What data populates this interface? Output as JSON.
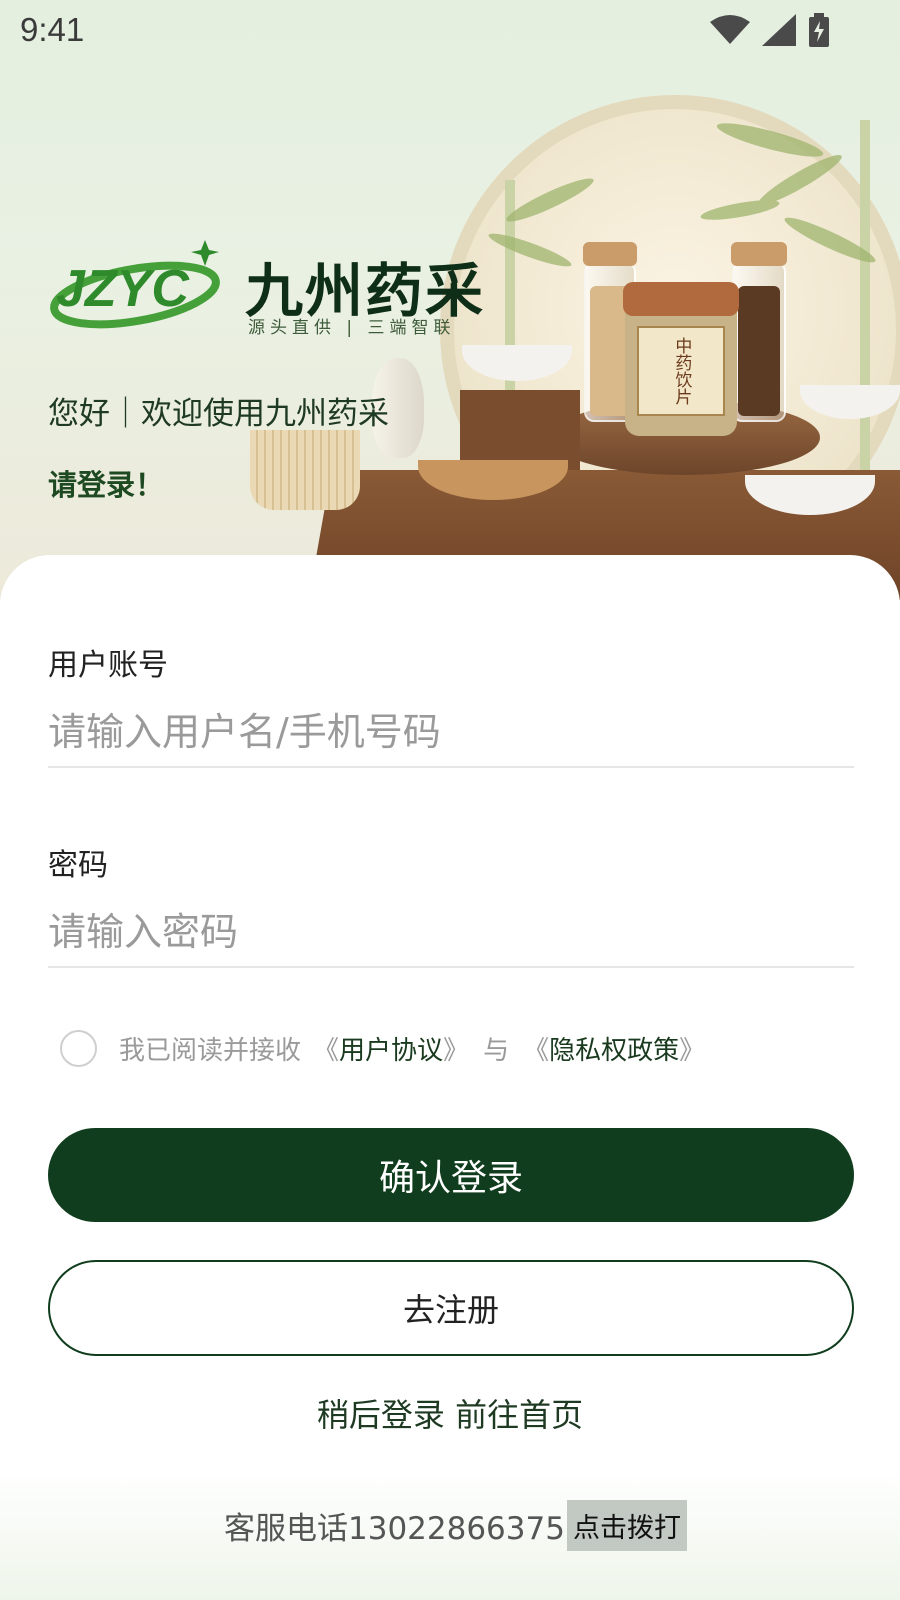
{
  "status_bar": {
    "time": "9:41",
    "icons": [
      "wifi-icon",
      "signal-icon",
      "battery-icon"
    ]
  },
  "brand": {
    "logo_letters": "JZYC",
    "name_cn": "九州药采",
    "slogan": "源头直供 | 三端智联",
    "jar_label": "中药饮片"
  },
  "hero": {
    "greeting": "您好｜欢迎使用九州药采",
    "prompt": "请登录！"
  },
  "form": {
    "account_label": "用户账号",
    "account_placeholder": "请输入用户名/手机号码",
    "password_label": "密码",
    "password_placeholder": "请输入密码"
  },
  "agreement": {
    "checked": false,
    "prefix": "我已阅读并接收",
    "open1": "《",
    "user_agreement": "用户协议",
    "close1": "》",
    "and": "与",
    "open2": "《",
    "privacy_policy": "隐私权政策",
    "close2": "》"
  },
  "buttons": {
    "login": "确认登录",
    "register": "去注册",
    "later_login": "稍后登录",
    "goto_home": "前往首页"
  },
  "footer": {
    "service_text": "客服电话13022866375",
    "call_label": "点击拨打"
  },
  "colors": {
    "primary": "#103d1d",
    "placeholder": "#9a9a9a"
  }
}
